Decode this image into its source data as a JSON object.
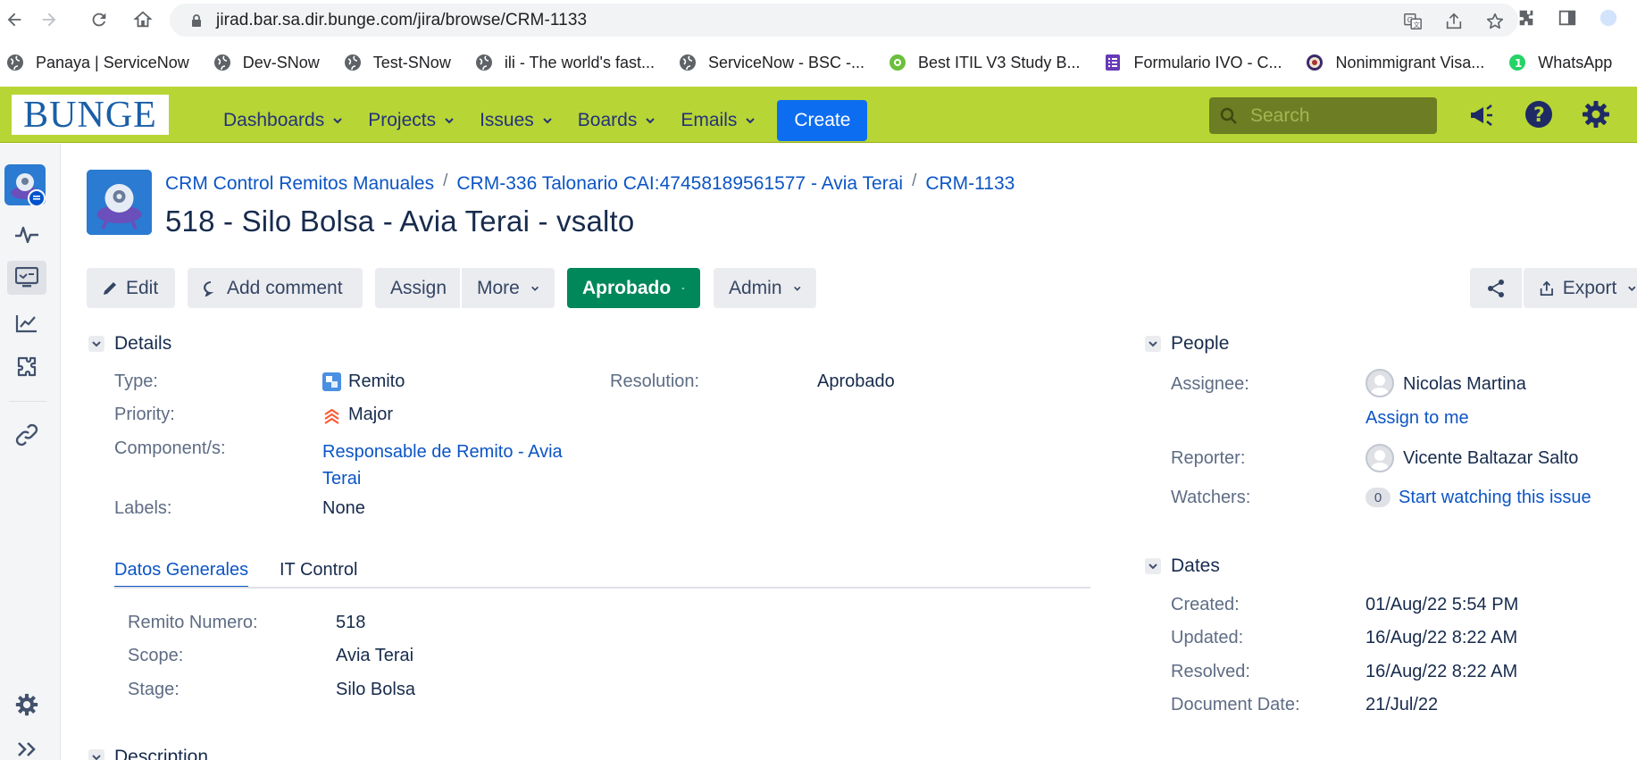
{
  "browser": {
    "url": "jirad.bar.sa.dir.bunge.com/jira/browse/CRM-1133",
    "bookmarks": [
      {
        "label": "Panaya | ServiceNow",
        "icon": "globe-icon"
      },
      {
        "label": "Dev-SNow",
        "icon": "globe-icon"
      },
      {
        "label": "Test-SNow",
        "icon": "globe-icon"
      },
      {
        "label": "ili - The world's fast...",
        "icon": "globe-icon"
      },
      {
        "label": "ServiceNow - BSC -...",
        "icon": "globe-icon"
      },
      {
        "label": "Best ITIL V3 Study B...",
        "icon": "green-circle-icon"
      },
      {
        "label": "Formulario IVO - C...",
        "icon": "purple-form-icon"
      },
      {
        "label": "Nonimmigrant Visa...",
        "icon": "seal-icon"
      },
      {
        "label": "WhatsApp",
        "icon": "whatsapp-icon"
      }
    ]
  },
  "header": {
    "logo_text": "BUNGE",
    "nav": [
      "Dashboards",
      "Projects",
      "Issues",
      "Boards",
      "Emails"
    ],
    "create_label": "Create",
    "search_placeholder": "Search"
  },
  "issue": {
    "breadcrumbs": [
      "CRM Control Remitos Manuales",
      "CRM-336 Talonario CAI:47458189561577 - Avia Terai",
      "CRM-1133"
    ],
    "title": "518 - Silo Bolsa - Avia Terai - vsalto"
  },
  "toolbar": {
    "edit": "Edit",
    "comment": "Add comment",
    "assign": "Assign",
    "more": "More",
    "status": "Aprobado",
    "admin": "Admin",
    "export": "Export"
  },
  "details": {
    "heading": "Details",
    "type_label": "Type:",
    "type_value": "Remito",
    "priority_label": "Priority:",
    "priority_value": "Major",
    "components_label": "Component/s:",
    "components_line1": "Responsable de Remito - Avia",
    "components_line2": "Terai",
    "labels_label": "Labels:",
    "labels_value": "None",
    "resolution_label": "Resolution:",
    "resolution_value": "Aprobado"
  },
  "tabs": {
    "tab1": "Datos Generales",
    "tab2": "IT Control"
  },
  "custom": {
    "remito_label": "Remito Numero:",
    "remito_value": "518",
    "scope_label": "Scope:",
    "scope_value": "Avia Terai",
    "stage_label": "Stage:",
    "stage_value": "Silo Bolsa"
  },
  "description": {
    "heading": "Description"
  },
  "people": {
    "heading": "People",
    "assignee_label": "Assignee:",
    "assignee_value": "Nicolas Martina",
    "assign_to_me": "Assign to me",
    "reporter_label": "Reporter:",
    "reporter_value": "Vicente Baltazar Salto",
    "watchers_label": "Watchers:",
    "watchers_count": "0",
    "watch_link": "Start watching this issue"
  },
  "dates": {
    "heading": "Dates",
    "created_label": "Created:",
    "created_value": "01/Aug/22 5:54 PM",
    "updated_label": "Updated:",
    "updated_value": "16/Aug/22 8:22 AM",
    "resolved_label": "Resolved:",
    "resolved_value": "16/Aug/22 8:22 AM",
    "docdate_label": "Document Date:",
    "docdate_value": "21/Jul/22"
  },
  "colors": {
    "header_bg": "#b7d534",
    "link": "#0c55c5",
    "create": "#0d6df0",
    "status_green": "#00875a"
  }
}
